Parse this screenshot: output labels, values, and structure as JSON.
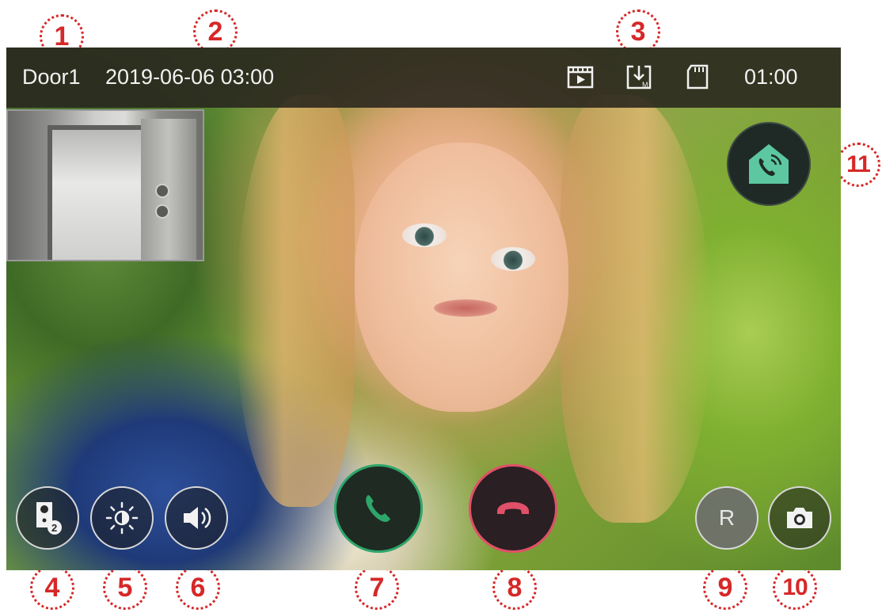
{
  "callouts": [
    "1",
    "2",
    "3",
    "4",
    "5",
    "6",
    "7",
    "8",
    "9",
    "10",
    "11"
  ],
  "status_bar": {
    "door_label": "Door1",
    "datetime": "2019-06-06 03:00",
    "timer": "01:00",
    "icons": [
      "video-record-icon",
      "memory-save-icon",
      "sd-card-icon"
    ]
  },
  "pip": {
    "icon": "door-camera-thumbnail"
  },
  "buttons": {
    "camera_switch": {
      "icon": "door-camera-icon",
      "badge": "2"
    },
    "brightness": {
      "icon": "brightness-icon"
    },
    "volume": {
      "icon": "speaker-icon"
    },
    "answer": {
      "icon": "phone-answer-icon",
      "color": "#2ea66a"
    },
    "hangup": {
      "icon": "phone-hangup-icon",
      "color": "#e05068"
    },
    "record": {
      "label": "R"
    },
    "snapshot": {
      "icon": "camera-icon"
    },
    "home_call": {
      "icon": "home-call-icon",
      "color": "#5cc7a0"
    }
  }
}
